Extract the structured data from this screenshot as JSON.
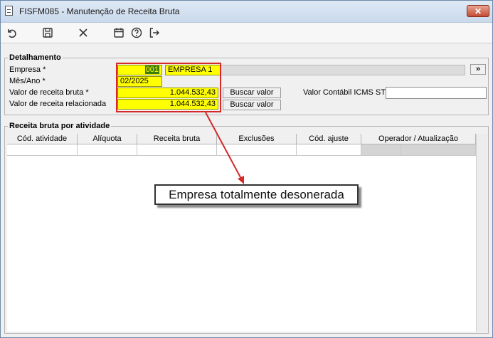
{
  "window": {
    "title": "FISFM085 - Manutenção de Receita Bruta",
    "close_label": "✕"
  },
  "toolbar": {
    "icons": [
      "undo-icon",
      "save-icon",
      "cancel-icon",
      "calendar-icon",
      "help-icon",
      "exit-icon"
    ]
  },
  "detalhamento": {
    "label": "Detalhamento",
    "empresa_label": "Empresa *",
    "empresa_code": "001",
    "empresa_name": "EMPRESA 1",
    "more_button": "»",
    "mes_ano_label": "Mês/Ano *",
    "mes_ano_value": "02/2025",
    "valor_receita_bruta_label": "Valor de receita bruta *",
    "valor_receita_bruta_value": "1.044.532,43",
    "valor_receita_relacionada_label": "Valor de receita relacionada",
    "valor_receita_relacionada_value": "1.044.532,43",
    "buscar_valor_label": "Buscar valor",
    "valor_contabil_label": "Valor Contábil ICMS ST",
    "valor_contabil_value": ""
  },
  "receita": {
    "label": "Receita bruta por atividade",
    "columns": [
      "Cód. atividade",
      "Alíquota",
      "Receita bruta",
      "Exclusões",
      "Cód. ajuste",
      "Operador / Atualização"
    ]
  },
  "callout": {
    "text": "Empresa totalmente desonerada"
  },
  "colors": {
    "highlight": "#ffff00",
    "annotation": "#d42a2a"
  }
}
